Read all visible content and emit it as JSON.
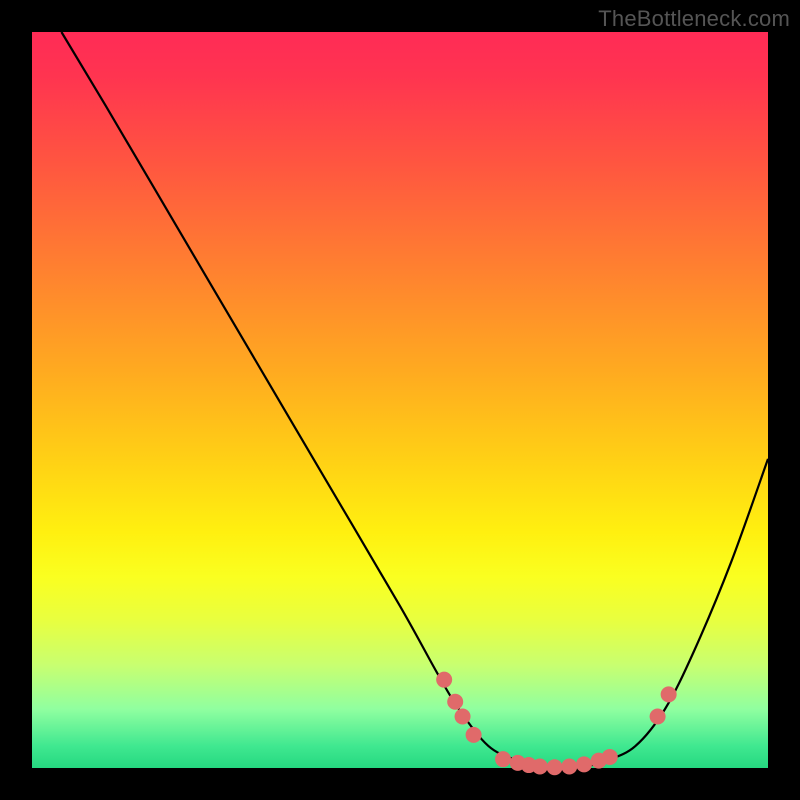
{
  "watermark": "TheBottleneck.com",
  "chart_data": {
    "type": "line",
    "title": "",
    "xlabel": "",
    "ylabel": "",
    "xlim": [
      0,
      100
    ],
    "ylim": [
      0,
      100
    ],
    "grid": false,
    "legend": false,
    "background_gradient": {
      "stops": [
        {
          "pos": 0,
          "color": "#ff2b56"
        },
        {
          "pos": 50,
          "color": "#ffd015"
        },
        {
          "pos": 80,
          "color": "#e8ff40"
        },
        {
          "pos": 100,
          "color": "#25d880"
        }
      ]
    },
    "series": [
      {
        "name": "bottleneck-curve",
        "color": "#000000",
        "x": [
          4,
          10,
          20,
          30,
          40,
          50,
          55,
          58,
          62,
          66,
          70,
          74,
          78,
          82,
          86,
          90,
          95,
          100
        ],
        "y": [
          100,
          90,
          73,
          56,
          39,
          22,
          13,
          8,
          3,
          1,
          0,
          0,
          1,
          3,
          8,
          16,
          28,
          42
        ]
      }
    ],
    "scatter_points": {
      "name": "highlighted-points",
      "color": "#e06a6a",
      "radius": 8,
      "points": [
        {
          "x": 56,
          "y": 12
        },
        {
          "x": 57.5,
          "y": 9
        },
        {
          "x": 58.5,
          "y": 7
        },
        {
          "x": 60,
          "y": 4.5
        },
        {
          "x": 64,
          "y": 1.2
        },
        {
          "x": 66,
          "y": 0.7
        },
        {
          "x": 67.5,
          "y": 0.4
        },
        {
          "x": 69,
          "y": 0.2
        },
        {
          "x": 71,
          "y": 0.1
        },
        {
          "x": 73,
          "y": 0.2
        },
        {
          "x": 75,
          "y": 0.5
        },
        {
          "x": 77,
          "y": 1.0
        },
        {
          "x": 78.5,
          "y": 1.5
        },
        {
          "x": 85,
          "y": 7
        },
        {
          "x": 86.5,
          "y": 10
        }
      ]
    }
  }
}
